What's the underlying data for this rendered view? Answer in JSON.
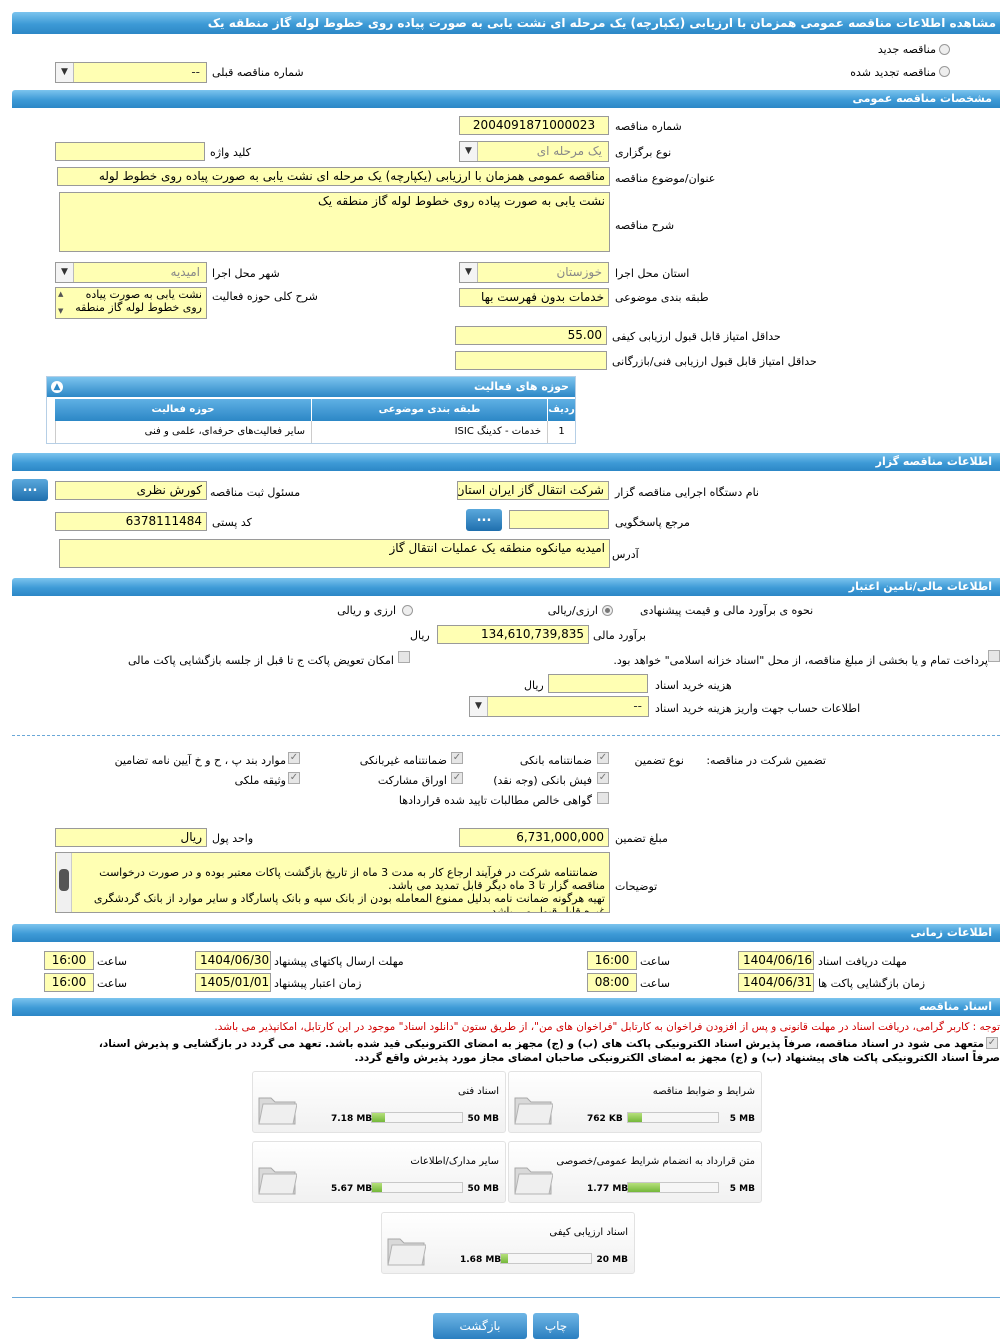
{
  "title": "مشاهده اطلاعات مناقصه عمومی همزمان با ارزیابی (یکپارچه) یک مرحله ای نشت یابی به صورت پیاده روی خطوط لوله گاز منطقه یک",
  "tender_type": {
    "new_label": "مناقصه جدید",
    "renewed_label": "مناقصه تجدید شده",
    "prev_number_label": "شماره مناقصه قبلی",
    "prev_number_value": "--"
  },
  "general": {
    "section_title": "مشخصات مناقصه عمومی",
    "number_label": "شماره مناقصه",
    "number_value": "2004091871000023",
    "type_label": "نوع برگزاری",
    "type_value": "یک مرحله ای",
    "keyword_label": "کلید واژه",
    "keyword_value": "",
    "subject_label": "عنوان/موضوع مناقصه",
    "subject_value": "مناقصه عمومی همزمان با ارزیابی (یکپارچه) یک مرحله ای نشت یابی به صورت پیاده روی خطوط لوله",
    "desc_label": "شرح مناقصه",
    "desc_value": "نشت یابی به صورت پیاده روی خطوط لوله گاز منطقه یک",
    "province_label": "استان محل اجرا",
    "province_value": "خوزستان",
    "city_label": "شهر محل اجرا",
    "city_value": "امیدیه",
    "category_label": "طبقه بندی موضوعی",
    "category_value": "خدمات بدون فهرست بها",
    "activity_label": "شرح کلی حوزه فعالیت",
    "activity_value": "نشت یابی به صورت پیاده روی خطوط لوله گاز منطقه",
    "min_quality_label": "حداقل امتیاز قابل قبول ارزیابی کیفی",
    "min_quality_value": "55.00",
    "min_tech_label": "حداقل امتیاز قابل قبول ارزیابی فنی/بازرگانی",
    "min_tech_value": ""
  },
  "activity_table": {
    "title": "حوزه های فعالیت",
    "headers": [
      "ردیف",
      "طبقه بندی موضوعی",
      "حوزه فعالیت"
    ],
    "rows": [
      [
        "1",
        "خدمات - کدینگ ISIC",
        "سایر فعالیت‌های حرفه‌ای، علمی و فنی"
      ]
    ]
  },
  "organizer": {
    "section_title": "اطلاعات مناقصه گزار",
    "org_label": "نام دستگاه اجرایی مناقصه گزار",
    "org_value": "شرکت انتقال گاز ایران  استان",
    "registrar_label": "مسئول ثبت مناقصه",
    "registrar_value": "کورش نظری",
    "ref_label": "مرجع پاسخگویی",
    "ref_value": "",
    "postal_label": "کد پستی",
    "postal_value": "6378111484",
    "address_label": "آدرس",
    "address_value": "امیدیه میانکوه منطقه یک عملیات انتقال گاز",
    "dots": "..."
  },
  "finance": {
    "section_title": "اطلاعات مالی/تامین اعتبار",
    "method_label": "نحوه ی برآورد مالی و قیمت پیشنهادی",
    "opt_rial_fx": "ارزی/ریالی",
    "opt_fx_and_rial": "ارزی و ریالی",
    "estimate_label": "برآورد مالی",
    "estimate_value": "134,610,739,835",
    "estimate_unit": "ریال",
    "treasury_label": "پرداخت تمام و یا بخشی از مبلغ مناقصه، از محل \"اسناد خزانه اسلامی\" خواهد بود.",
    "swap_label": "امکان تعویض پاکت ج تا قبل از جلسه بازگشایی پاکت مالی",
    "doc_cost_label": "هزینه خرید اسناد",
    "doc_cost_value": "",
    "doc_cost_unit": "ریال",
    "account_label": "اطلاعات حساب جهت واریز هزینه خرید اسناد",
    "account_value": "--"
  },
  "guarantee": {
    "label": "تضمین شرکت در مناقصه:",
    "type_label": "نوع تضمین",
    "options": {
      "bank_guarantee": "ضمانتنامه بانکی",
      "non_bank_guarantee": "ضمانتنامه غیربانکی",
      "clauses": "موارد بند پ ، ح و خ آیین نامه تضامین",
      "bank_receipt": "فیش بانکی (وجه نقد)",
      "bonds": "اوراق مشارکت",
      "property": "وثیقه ملکی",
      "receivables": "گواهی خالص مطالبات تایید شده قراردادها"
    },
    "amount_label": "مبلغ تضمین",
    "amount_value": "6,731,000,000",
    "currency_label": "واحد پول",
    "currency_value": "ریال",
    "notes_label": "توضیحات",
    "notes_value": "ضمانتنامه شرکت در فرآیند ارجاع کار به مدت 3 ماه از تاریخ بازگشت پاکات معتبر بوده و در صورت درخواست مناقصه گزار تا 3 ماه دیگر قابل تمدید می باشد.\nتهیه هرگونه ضمانت نامه بدلیل ممنوع المعامله بودن از بانک سپه و بانک پاسارگاد و سایر موارد از بانک گردشگری غیره قابل قبول می باشد."
  },
  "timing": {
    "section_title": "اطلاعات زمانی",
    "receive_label": "مهلت دریافت اسناد",
    "receive_date": "1404/06/16",
    "receive_time": "16:00",
    "submit_label": "مهلت ارسال پاکتهای پیشنهاد",
    "submit_date": "1404/06/30",
    "submit_time": "16:00",
    "open_label": "زمان بازگشایی پاکت ها",
    "open_date": "1404/06/31",
    "open_time": "08:00",
    "validity_label": "زمان اعتبار پیشنهاد",
    "validity_date": "1405/01/01",
    "validity_time": "16:00",
    "time_label": "ساعت"
  },
  "documents": {
    "section_title": "اسناد مناقصه",
    "note": "توجه : کاربر گرامی، دریافت اسناد در مهلت قانونی و پس از افزودن فراخوان به کارتابل \"فراخوان های من\"، از طریق ستون \"دانلود اسناد\" موجود در این کارتابل، امکانپذیر می باشد.",
    "commit_1": "متعهد می شود در اسناد مناقصه، صرفاً پذیرش اسناد الکترونیکی پاکت های (ب) و (ج) مجهز به امضای الکترونیکی قید شده باشد. تعهد می گردد در بازگشایی و پذیرش اسناد،",
    "commit_2": "صرفاً اسناد الکترونیکی پاکت های پیشنهاد (ب) و (ج) مجهز به امضای الکترونیکی صاحبان امضای مجاز مورد پذیرش واقع گردد.",
    "files": [
      {
        "name": "شرایط و ضوابط مناقصه",
        "size": "762 KB",
        "max": "5 MB",
        "fill": 0.15
      },
      {
        "name": "اسناد فنی",
        "size": "7.18 MB",
        "max": "50 MB",
        "fill": 0.14
      },
      {
        "name": "متن قرارداد به انضمام شرایط عمومی/خصوصی",
        "size": "1.77 MB",
        "max": "5 MB",
        "fill": 0.35
      },
      {
        "name": "سایر مدارک/اطلاعات",
        "size": "5.67 MB",
        "max": "50 MB",
        "fill": 0.11
      },
      {
        "name": "اسناد ارزیابی کیفی",
        "size": "1.68 MB",
        "max": "20 MB",
        "fill": 0.08
      }
    ]
  },
  "actions": {
    "print": "چاپ",
    "back": "بازگشت"
  }
}
